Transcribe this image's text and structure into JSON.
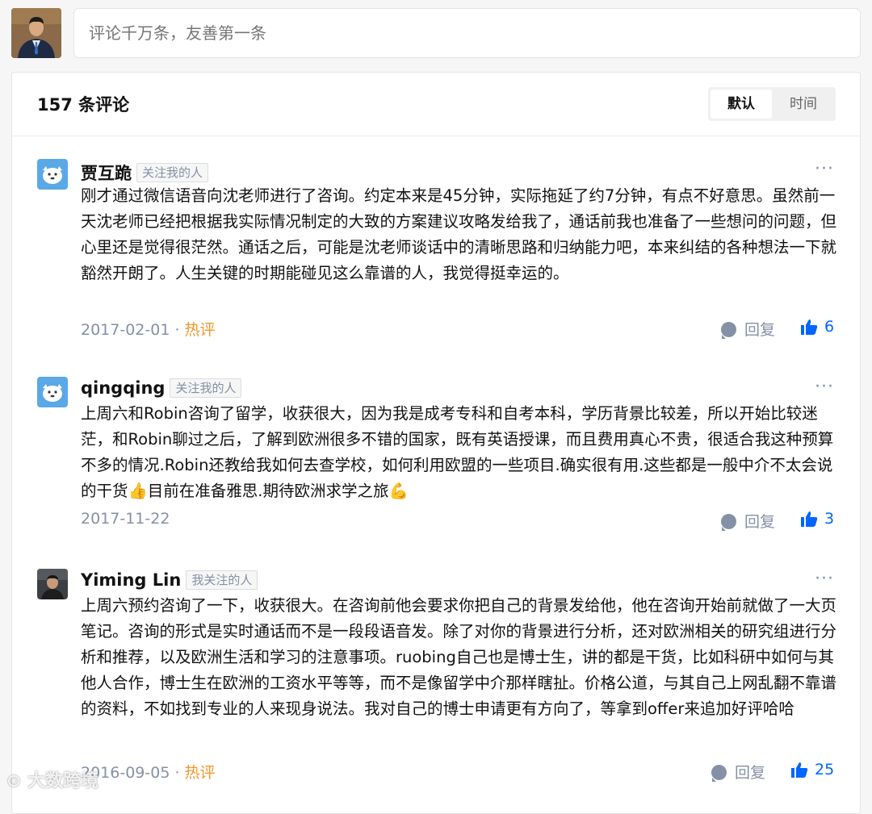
{
  "composer": {
    "placeholder": "评论千万条，友善第一条"
  },
  "header": {
    "count_label": "157 条评论",
    "sort_options": [
      "默认",
      "时间"
    ],
    "active_sort": "默认"
  },
  "comments": [
    {
      "author": "贾互跪",
      "tag": "关注我的人",
      "text": "刚才通过微信语音向沈老师进行了咨询。约定本来是45分钟，实际拖延了约7分钟，有点不好意思。虽然前一天沈老师已经把根据我实际情况制定的大致的方案建议攻略发给我了，通话前我也准备了一些想问的问题，但心里还是觉得很茫然。通话之后，可能是沈老师谈话中的清晰思路和归纳能力吧，本来纠结的各种想法一下就豁然开朗了。人生关键的时期能碰见这么靠谱的人，我觉得挺幸运的。",
      "date": "2017-02-01",
      "hot": "热评",
      "reply_label": "回复",
      "likes": "6"
    },
    {
      "author": "qingqing",
      "tag": "关注我的人",
      "text": "上周六和Robin咨询了留学，收获很大，因为我是成考专科和自考本科，学历背景比较差，所以开始比较迷茫，和Robin聊过之后，了解到欧洲很多不错的国家，既有英语授课，而且费用真心不贵，很适合我这种预算不多的情况.Robin还教给我如何去查学校，如何利用欧盟的一些项目.确实很有用.这些都是一般中介不太会说的干货👍目前在准备雅思.期待欧洲求学之旅💪",
      "date": "2017-11-22",
      "hot": "",
      "reply_label": "回复",
      "likes": "3"
    },
    {
      "author": "Yiming Lin",
      "tag": "我关注的人",
      "text": "上周六预约咨询了一下，收获很大。在咨询前他会要求你把自己的背景发给他，他在咨询开始前就做了一大页笔记。咨询的形式是实时通话而不是一段段语音发。除了对你的背景进行分析，还对欧洲相关的研究组进行分析和推荐，以及欧洲生活和学习的注意事项。ruobing自己也是博士生，讲的都是干货，比如科研中如何与其他人合作，博士生在欧洲的工资水平等等，而不是像留学中介那样瞎扯。价格公道，与其自己上网乱翻不靠谱的资料，不如找到专业的人来现身说法。我对自己的博士申请更有方向了，等拿到offer来追加好评哈哈",
      "date": "2016-09-05",
      "hot": "热评",
      "reply_label": "回复",
      "likes": "25"
    }
  ],
  "watermark": "大数跨境",
  "colors": {
    "accent": "#0066ff",
    "hot": "#f1972b",
    "muted": "#8590a6"
  }
}
